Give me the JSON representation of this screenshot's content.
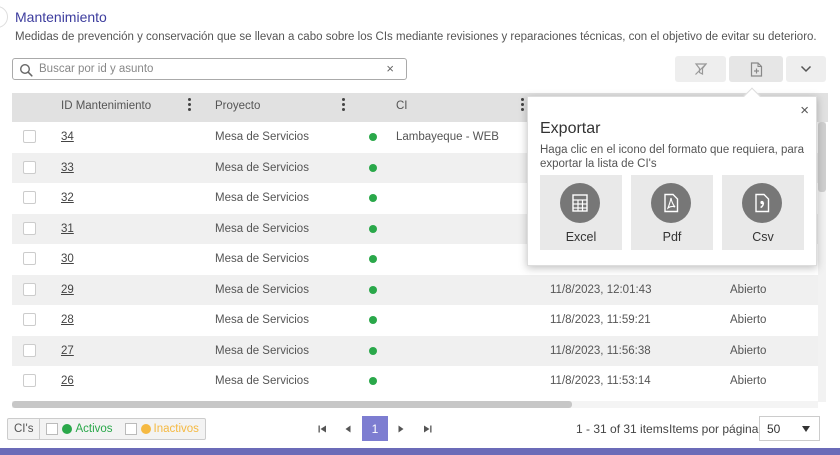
{
  "header": {
    "title": "Mantenimiento",
    "description": "Medidas de prevención y conservación que se llevan a cabo sobre los CIs mediante revisiones y reparaciones técnicas, con el objetivo de evitar su deterioro."
  },
  "search": {
    "placeholder": "Buscar por id y asunto",
    "value": "",
    "clear": "×"
  },
  "toolbar": {
    "icons": [
      "filter-off-icon",
      "export-file-icon",
      "chevron-down-icon"
    ]
  },
  "grid": {
    "columns": [
      "ID Mantenimiento",
      "Proyecto",
      "CI"
    ],
    "rows": [
      {
        "id": "34",
        "project": "Mesa de Servicios",
        "ci": "Lambayeque - WEB",
        "date": "",
        "status": ""
      },
      {
        "id": "33",
        "project": "Mesa de Servicios",
        "ci": "",
        "date": "",
        "status": ""
      },
      {
        "id": "32",
        "project": "Mesa de Servicios",
        "ci": "",
        "date": "",
        "status": ""
      },
      {
        "id": "31",
        "project": "Mesa de Servicios",
        "ci": "",
        "date": "",
        "status": ""
      },
      {
        "id": "30",
        "project": "Mesa de Servicios",
        "ci": "",
        "date": "",
        "status": ""
      },
      {
        "id": "29",
        "project": "Mesa de Servicios",
        "ci": "",
        "date": "11/8/2023, 12:01:43",
        "status": "Abierto"
      },
      {
        "id": "28",
        "project": "Mesa de Servicios",
        "ci": "",
        "date": "11/8/2023, 11:59:21",
        "status": "Abierto"
      },
      {
        "id": "27",
        "project": "Mesa de Servicios",
        "ci": "",
        "date": "11/8/2023, 11:56:38",
        "status": "Abierto"
      },
      {
        "id": "26",
        "project": "Mesa de Servicios",
        "ci": "",
        "date": "11/8/2023, 11:53:14",
        "status": "Abierto"
      }
    ]
  },
  "export_popover": {
    "title": "Exportar",
    "description": "Haga clic en el icono del formato que requiera, para exportar la lista de CI's",
    "close": "×",
    "options": [
      {
        "label": "Excel",
        "icon": "spreadsheet-icon"
      },
      {
        "label": "Pdf",
        "icon": "pdf-icon"
      },
      {
        "label": "Csv",
        "icon": "csv-icon"
      }
    ]
  },
  "legend": {
    "title": "CI's",
    "active": "Activos",
    "inactive": "Inactivos",
    "active_color": "#2aa84a",
    "inactive_color": "#f5b942"
  },
  "pager": {
    "current_page": "1",
    "items_info": "1 - 31 of 31 items",
    "per_page_label": "Items por página",
    "per_page_value": "50"
  },
  "colors": {
    "accent": "#3d3d9e",
    "pager_active": "#7d7dd1",
    "status_dot": "#2aa84a",
    "bottom_bar": "#6b6bb8"
  }
}
